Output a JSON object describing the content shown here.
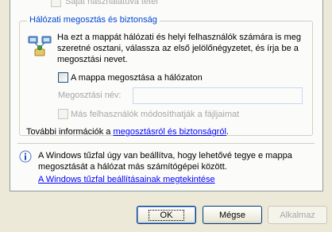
{
  "private_checkbox": {
    "label": "Saját használatúvá tétel",
    "checked": false,
    "enabled": false
  },
  "network_sharing": {
    "group_title": "Hálózati megosztás és biztonság",
    "description": "Ha ezt a mappát hálózati és helyi felhasználók számára is meg szeretné osztani, válassza az első jelölőnégyzetet, és írja be a megosztási nevet.",
    "share_checkbox": {
      "label": "A mappa megosztása a hálózaton",
      "checked": false
    },
    "share_name": {
      "label": "Megosztási név:",
      "value": ""
    },
    "allow_change_checkbox": {
      "label": "Más felhasználók módosíthatják a fájljaimat",
      "checked": false,
      "enabled": false
    },
    "more_info_prefix": "További információk a ",
    "more_info_link": "megosztásról és biztonságról",
    "more_info_suffix": "."
  },
  "firewall": {
    "message": "A Windows tűzfal úgy van beállítva, hogy lehetővé tegye e mappa megosztását a hálózat más számítógépei között.",
    "link": "A Windows tűzfal beállításainak megtekintése"
  },
  "buttons": {
    "ok": "OK",
    "cancel": "Mégse",
    "apply": "Alkalmaz"
  },
  "icons": {
    "network": "network-share-icon",
    "info": "info-icon"
  },
  "colors": {
    "group_title": "#0046d5",
    "link": "#0000ff",
    "disabled_text": "#a7a6aa",
    "dialog_bg": "#ece9d8"
  }
}
